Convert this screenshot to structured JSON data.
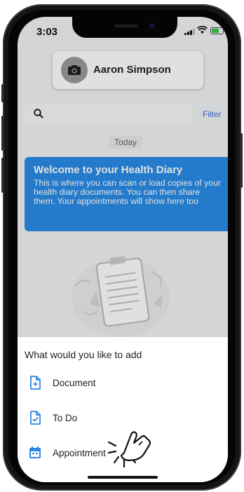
{
  "status_bar": {
    "time": "3:03",
    "signal_icon": "signal-icon",
    "wifi_icon": "wifi-icon",
    "battery_icon": "battery-icon"
  },
  "profile": {
    "name": "Aaron Simpson",
    "icon": "camera-icon"
  },
  "search": {
    "icon": "search-icon",
    "filter_label": "Filter"
  },
  "date_separator": "Today",
  "welcome": {
    "title": "Welcome to your Health Diary",
    "body": "This is where you can scan or load copies of your health diary documents. You can then share them. Your appointments will show here too"
  },
  "sheet": {
    "title": "What would you like to add",
    "items": [
      {
        "label": "Document",
        "icon": "document-icon"
      },
      {
        "label": "To Do",
        "icon": "todo-icon"
      },
      {
        "label": "Appointment",
        "icon": "calendar-icon"
      }
    ]
  },
  "colors": {
    "accent": "#2b8ce8",
    "filter": "#3a6fe0",
    "icon_blue": "#2d86e6"
  }
}
